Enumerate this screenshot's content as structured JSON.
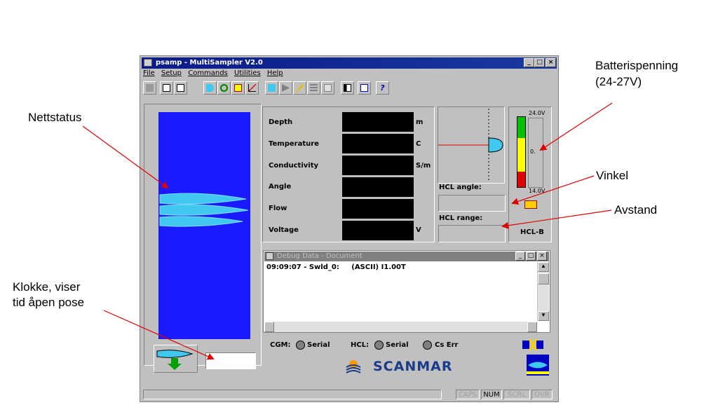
{
  "annotations": {
    "nettstatus": "Nettstatus",
    "battery_line1": "Batterispenning",
    "battery_line2": "(24-27V)",
    "vinkel": "Vinkel",
    "avstand": "Avstand",
    "clock_line1": "Klokke, viser",
    "clock_line2": "tid åpen pose"
  },
  "window": {
    "title": "psamp - MultiSampler V2.0",
    "minimize": "_",
    "maximize": "□",
    "close": "×"
  },
  "menu": [
    "File",
    "Setup",
    "Commands",
    "Utilities",
    "Help"
  ],
  "toolbar_icons": [
    "new-icon",
    "open-icon",
    "save-icon",
    "sensor-icon",
    "cable-icon",
    "battery-icon",
    "chart-icon",
    "download-icon",
    "next-icon",
    "wrench-icon",
    "list-icon",
    "page-icon",
    "layout-icon",
    "signal-icon",
    "help-icon"
  ],
  "readings": [
    {
      "label": "Depth",
      "unit": "m"
    },
    {
      "label": "Temperature",
      "unit": "C"
    },
    {
      "label": "Conductivity",
      "unit": "S/m"
    },
    {
      "label": "Angle",
      "unit": ""
    },
    {
      "label": "Flow",
      "unit": ""
    },
    {
      "label": "Voltage",
      "unit": "V"
    }
  ],
  "hcl": {
    "angle_label": "HCL angle:",
    "range_label": "HCL range:",
    "device": "HCL-B"
  },
  "battery": {
    "max": "24.0V",
    "mid": "0.",
    "min": "14.0V"
  },
  "debug": {
    "title": "Debug Data - Document",
    "line": "09:09:07 - Swld_0:     (ASCII) I1.00T"
  },
  "status_row": {
    "cgm": "CGM:",
    "cgm_serial": "Serial",
    "hcl": "HCL:",
    "hcl_serial": "Serial",
    "cs_err": "Cs Err"
  },
  "brand": "SCANMAR",
  "clock_value": "",
  "indicators": [
    "CAPS",
    "NUM",
    "SCRL",
    "OVR"
  ],
  "colors": {
    "net_panel": "#1a1aff",
    "net_shape": "#40c8f0",
    "battery_green": "#00c000",
    "battery_yellow": "#ffff00",
    "battery_red": "#e00000",
    "brand": "#1a3a8a"
  }
}
